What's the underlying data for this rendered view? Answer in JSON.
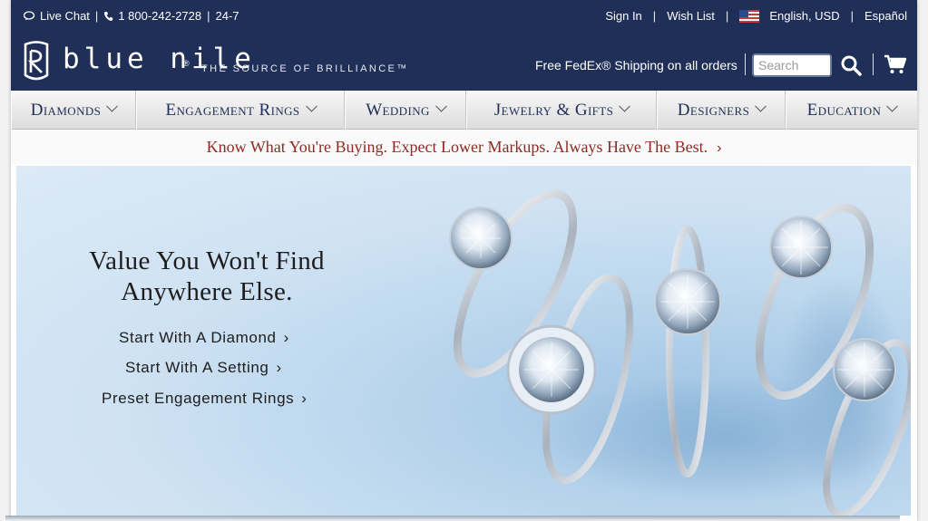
{
  "topbar": {
    "live_chat": "Live Chat",
    "phone": "1 800-242-2728",
    "hours": "24-7",
    "sign_in": "Sign In",
    "wish_list": "Wish List",
    "language": "English, USD",
    "espanol": "Español",
    "separator": "|"
  },
  "header": {
    "brand": "blue nile",
    "registered": "®",
    "tagline": "THE SOURCE OF BRILLIANCE™",
    "shipping": "Free FedEx® Shipping on all orders",
    "search_placeholder": "Search"
  },
  "nav": {
    "items": [
      {
        "label": "Diamonds"
      },
      {
        "label": "Engagement Rings"
      },
      {
        "label": "Wedding"
      },
      {
        "label": "Jewelry & Gifts"
      },
      {
        "label": "Designers"
      },
      {
        "label": "Education"
      }
    ]
  },
  "promo": {
    "text": "Know What You're Buying. Expect Lower Markups. Always Have The Best.",
    "arrow": "›"
  },
  "hero": {
    "title_line1": "Value You Won't Find",
    "title_line2": "Anywhere Else.",
    "links": [
      {
        "label": "Start With A Diamond"
      },
      {
        "label": "Start With A Setting"
      },
      {
        "label": "Preset Engagement Rings"
      }
    ],
    "arrow": "›"
  },
  "colors": {
    "navy": "#1f2f57",
    "promo_red": "#8e2a22",
    "nav_text": "#1f2f57"
  },
  "icons": {
    "chat": "chat-icon",
    "phone": "phone-icon",
    "flag": "us-flag-icon",
    "search": "search-icon",
    "cart": "cart-icon",
    "logo": "blue-nile-logo-icon"
  }
}
